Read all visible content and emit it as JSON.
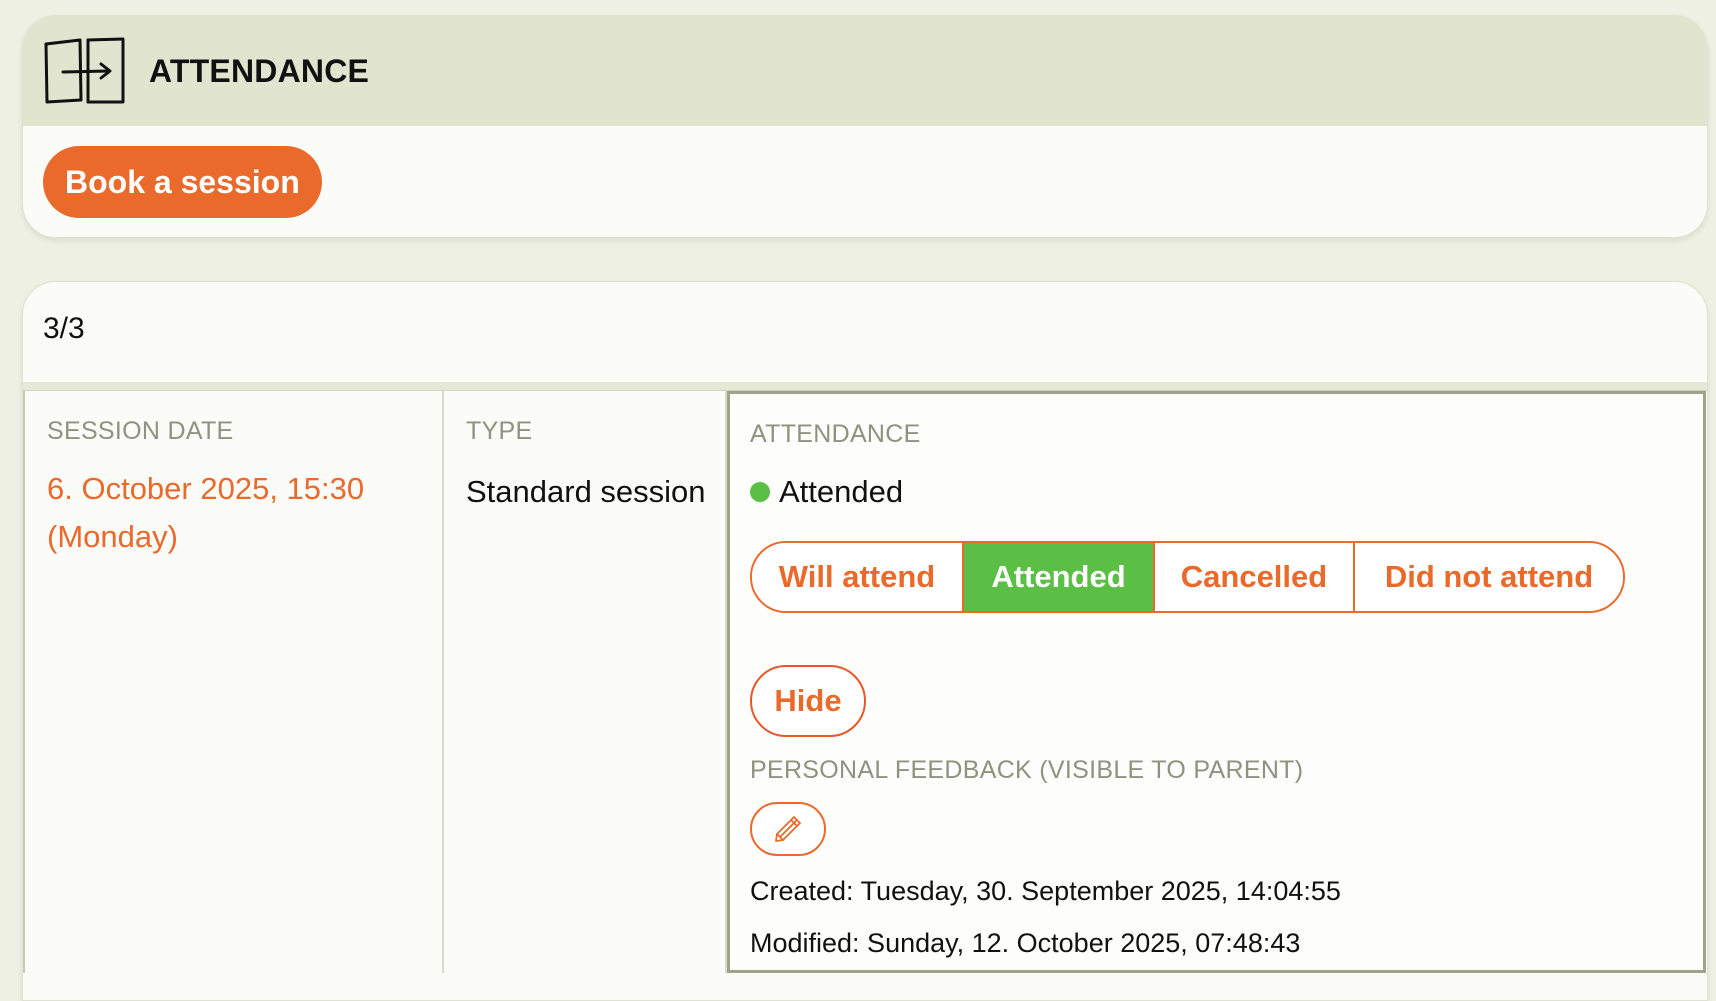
{
  "header": {
    "title": "ATTENDANCE",
    "icon": "door-enter-icon"
  },
  "actions": {
    "book_label": "Book a session"
  },
  "pagination": {
    "count": "3/3"
  },
  "session": {
    "date_label": "SESSION DATE",
    "date_value": "6. October 2025, 15:30 (Monday)",
    "type_label": "TYPE",
    "type_value": "Standard session",
    "attendance_label": "ATTENDANCE",
    "status": "Attended",
    "status_color": "#5cbf45",
    "options": [
      {
        "label": "Will attend",
        "selected": false
      },
      {
        "label": "Attended",
        "selected": true
      },
      {
        "label": "Cancelled",
        "selected": false
      },
      {
        "label": "Did not attend",
        "selected": false
      }
    ],
    "hide_label": "Hide",
    "feedback_label": "PERSONAL FEEDBACK (VISIBLE TO PARENT)",
    "edit_icon": "pencil-icon",
    "created": "Created: Tuesday, 30. September 2025, 14:04:55",
    "modified": "Modified: Sunday, 12. October 2025, 07:48:43"
  },
  "colors": {
    "accent": "#ea6a2b",
    "success": "#5cbf45",
    "header_bg": "#e1e4cf",
    "page_bg": "#eef0e3",
    "muted_label": "#8f9280"
  }
}
